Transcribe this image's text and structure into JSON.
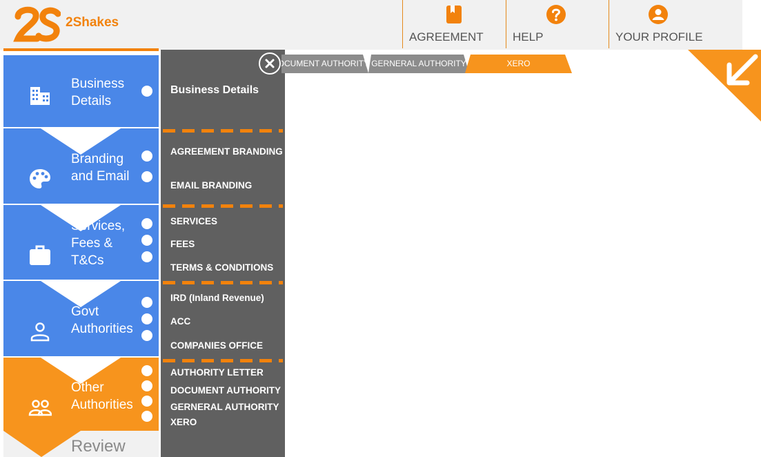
{
  "header": {
    "brand": "2Shakes",
    "logo_text": "2S",
    "nav": [
      {
        "label": "AGREEMENT",
        "icon": "book-icon"
      },
      {
        "label": "HELP",
        "icon": "help-icon"
      },
      {
        "label": "YOUR PROFILE",
        "icon": "user-icon"
      }
    ]
  },
  "steps": [
    {
      "lines": [
        "Business",
        "Details"
      ],
      "icon": "building-icon",
      "color": "#4a87e8"
    },
    {
      "lines": [
        "Branding",
        "and Email"
      ],
      "icon": "palette-icon",
      "color": "#4a87e8"
    },
    {
      "lines": [
        "Services,",
        "Fees &",
        "T&Cs"
      ],
      "icon": "briefcase-icon",
      "color": "#4a87e8"
    },
    {
      "lines": [
        "Govt",
        "Authorities"
      ],
      "icon": "person-icon",
      "color": "#4a87e8"
    },
    {
      "lines": [
        "Other",
        "Authorities"
      ],
      "icon": "group-icon",
      "color": "#f7941d"
    }
  ],
  "review_label": "Review",
  "panel": {
    "title": "Business Details",
    "links": [
      "AGREEMENT BRANDING",
      "EMAIL BRANDING",
      "SERVICES",
      "FEES",
      "TERMS & CONDITIONS",
      "IRD (Inland Revenue)",
      "ACC",
      "COMPANIES OFFICE",
      "AUTHORITY LETTER",
      "DOCUMENT AUTHORITY",
      "GERNERAL AUTHORITY",
      "XERO"
    ]
  },
  "tabs": [
    {
      "label": "DOCUMENT AUTHORITY",
      "active": false
    },
    {
      "label": "GERNERAL AUTHORITY",
      "active": false
    },
    {
      "label": "XERO",
      "active": true
    }
  ],
  "colors": {
    "accent": "#f2820c",
    "step_blue": "#4a87e8",
    "step_orange": "#f7941d",
    "panel": "#606060",
    "tab_inactive": "#8c8c8c"
  }
}
